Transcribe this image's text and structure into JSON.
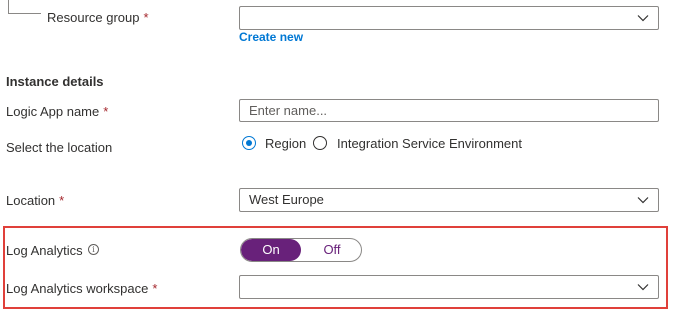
{
  "resource_group": {
    "label": "Resource group",
    "required": "*",
    "value": "",
    "create_new": "Create new"
  },
  "instance_details": {
    "heading": "Instance details"
  },
  "logic_app_name": {
    "label": "Logic App name",
    "required": "*",
    "placeholder": "Enter name..."
  },
  "location_type": {
    "label": "Select the location",
    "options": [
      {
        "label": "Region",
        "selected": true
      },
      {
        "label": "Integration Service Environment",
        "selected": false
      }
    ]
  },
  "location": {
    "label": "Location",
    "required": "*",
    "value": "West Europe"
  },
  "log_analytics": {
    "label": "Log Analytics",
    "info_glyph": "i",
    "on_label": "On",
    "off_label": "Off",
    "state": "On"
  },
  "log_analytics_workspace": {
    "label": "Log Analytics workspace",
    "required": "*",
    "value": ""
  },
  "colors": {
    "accent": "#0078d4",
    "toggle_on": "#68217a",
    "highlight": "#e0403a",
    "required": "#a4262c"
  }
}
